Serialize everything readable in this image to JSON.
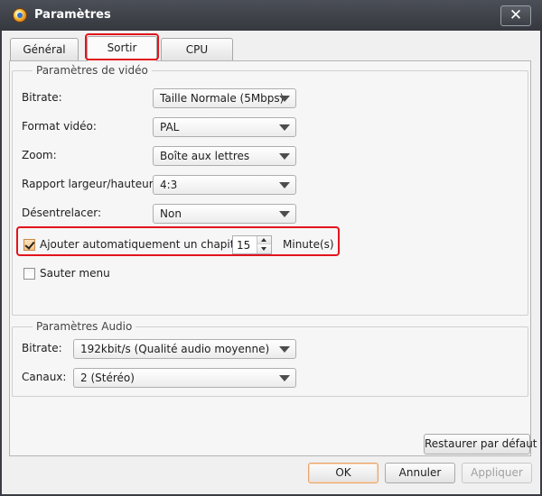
{
  "window": {
    "title": "Paramètres",
    "close_label": "✕"
  },
  "tabs": [
    {
      "label": "Général",
      "active": false
    },
    {
      "label": "Sortir",
      "active": true
    },
    {
      "label": "CPU",
      "active": false
    }
  ],
  "video": {
    "group_title": "Paramètres de vidéo",
    "bitrate": {
      "label": "Bitrate:",
      "value": "Taille Normale (5Mbps)"
    },
    "format": {
      "label": "Format vidéo:",
      "value": "PAL"
    },
    "zoom": {
      "label": "Zoom:",
      "value": "Boîte aux lettres"
    },
    "ratio": {
      "label": "Rapport largeur/hauteur:",
      "value": "4:3"
    },
    "deinterlace": {
      "label": "Désentrelacer:",
      "value": "Non"
    },
    "auto_chapter": {
      "label": "Ajouter automatiquement un chapitre:",
      "checked": true,
      "value": "15",
      "unit": "Minute(s)"
    },
    "skip_menu": {
      "label": "Sauter menu",
      "checked": false
    }
  },
  "audio": {
    "group_title": "Paramètres Audio",
    "bitrate": {
      "label": "Bitrate:",
      "value": "192kbit/s (Qualité audio moyenne)"
    },
    "channels": {
      "label": "Canaux:",
      "value": "2 (Stéréo)"
    }
  },
  "buttons": {
    "restore": "Restaurer par défaut",
    "ok": "OK",
    "cancel": "Annuler",
    "apply": "Appliquer"
  },
  "colors": {
    "highlight_red": "#e2141c",
    "titlebar": "#3a3d44",
    "ok_border": "#e8a46c"
  }
}
